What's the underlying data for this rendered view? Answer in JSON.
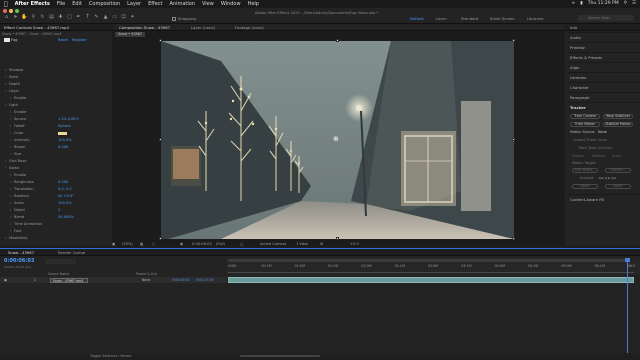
{
  "menubar": {
    "app_name": "After Effects",
    "menus": [
      "File",
      "Edit",
      "Composition",
      "Layer",
      "Effect",
      "Animation",
      "View",
      "Window",
      "Help"
    ],
    "clock": "Thu 11:29 PM"
  },
  "window_title": "Adobe After Effects 2020 - /Users/admin/Documents/Fog Video.aep *",
  "toolbar": {
    "snapping_label": "Snapping",
    "workspaces": [
      "Default",
      "Learn",
      "Standard",
      "Small Screen",
      "Libraries"
    ],
    "active_workspace": "Default",
    "search_placeholder": "Search Help"
  },
  "effect_controls": {
    "tab_label": "Effect Controls Snow - 43967.mp4",
    "breadcrumb": "Snow • 43967 - Snow - 43967.mp4",
    "fx_name": "Fog",
    "reset_label": "Reset",
    "register_label": "Register",
    "rows": [
      {
        "label": "Shadow",
        "indent": 1,
        "value": ""
      },
      {
        "label": "Seed",
        "indent": 1,
        "value": ""
      },
      {
        "label": "Depth",
        "indent": 1,
        "value": ""
      },
      {
        "label": "Layer",
        "indent": 1,
        "value": ""
      },
      {
        "label": "Enable",
        "indent": 2,
        "value": ""
      },
      {
        "label": "Light",
        "indent": 1,
        "value": ""
      },
      {
        "label": "Enable",
        "indent": 2,
        "value": ""
      },
      {
        "label": "Source",
        "indent": 2,
        "value": "1.34.1/49.9"
      },
      {
        "label": "Falloff",
        "indent": 2,
        "value": "Sphere"
      },
      {
        "label": "Color",
        "indent": 2,
        "value": ""
      },
      {
        "label": "Intensity",
        "indent": 2,
        "value": "100.0%"
      },
      {
        "label": "Bloom",
        "indent": 2,
        "value": "0.000"
      },
      {
        "label": "Size",
        "indent": 2,
        "value": ""
      },
      {
        "label": "Grid Base",
        "indent": 1,
        "value": ""
      },
      {
        "label": "Noise",
        "indent": 1,
        "value": ""
      },
      {
        "label": "Enable",
        "indent": 2,
        "value": ""
      },
      {
        "label": "Roughness",
        "indent": 2,
        "value": "0.000"
      },
      {
        "label": "Translation",
        "indent": 2,
        "value": "0.0, 0.0"
      },
      {
        "label": "Rotation",
        "indent": 2,
        "value": "0x +0.0°"
      },
      {
        "label": "Scale",
        "indent": 2,
        "value": "100.0%"
      },
      {
        "label": "Detail",
        "indent": 2,
        "value": "2"
      },
      {
        "label": "Blend",
        "indent": 2,
        "value": "50.000%"
      },
      {
        "label": "Time Animation",
        "indent": 2,
        "value": ""
      },
      {
        "label": "Fold",
        "indent": 2,
        "value": ""
      },
      {
        "label": "Masterkey",
        "indent": 1,
        "value": ""
      }
    ]
  },
  "composition": {
    "tab_label": "Composition Snow - 43967",
    "sub_tab": "Snow • 43967",
    "layer_tab": "Layer (none)",
    "footage_tab": "Footage (none)",
    "zoom": "(55%)",
    "timecode": "0:00:06:03",
    "resolution": "(Full)",
    "camera": "Active Camera",
    "views": "1 View",
    "exposure": "+0.0"
  },
  "right_panel": {
    "items": [
      "Info",
      "Audio",
      "Preview",
      "Effects & Presets",
      "Align",
      "Libraries",
      "Character",
      "Paragraph",
      "Tracker"
    ],
    "tracker": {
      "buttons": [
        "Track Camera",
        "Warp Stabilizer",
        "Track Motion",
        "Stabilize Motion"
      ],
      "motion_source_label": "Motion Source:",
      "motion_source_value": "None",
      "current_track_label": "Current Track:",
      "current_track_value": "None",
      "track_type_label": "Track Type:",
      "track_type_value": "Stabilize",
      "checkboxes": [
        "Position",
        "Rotation",
        "Scale"
      ],
      "motion_target_label": "Motion Target:",
      "edit_target": "Edit Target...",
      "options": "Options...",
      "analyze_label": "Analyze:",
      "reset": "Reset",
      "apply": "Apply"
    },
    "content_aware_fill": "Content-Aware Fill"
  },
  "timeline": {
    "tab_label": "Snow - 43967",
    "render_queue_label": "Render Queue",
    "timecode": "0:00:06:03",
    "frame_info": "00183 (30.00 fps)",
    "columns": [
      "Source Name",
      "Parent & Link"
    ],
    "layer_number": "1",
    "layer_name": "Snow - 43967.mp4",
    "parent_value": "None",
    "in_time": "0:00:00:00",
    "out_time": "0:00:17:29",
    "ruler_labels": [
      "0:00f",
      "00:15f",
      "01:00f",
      "01:15f",
      "02:00f",
      "02:15f",
      "03:00f",
      "03:15f",
      "04:00f",
      "04:15f",
      "05:00f",
      "05:15f",
      "06:0"
    ],
    "footer_label": "Toggle Switches / Modes"
  },
  "colors": {
    "accent_blue": "#4a9cff",
    "layer_bar": "#6a9a9a",
    "playhead": "#4a7fd8"
  }
}
